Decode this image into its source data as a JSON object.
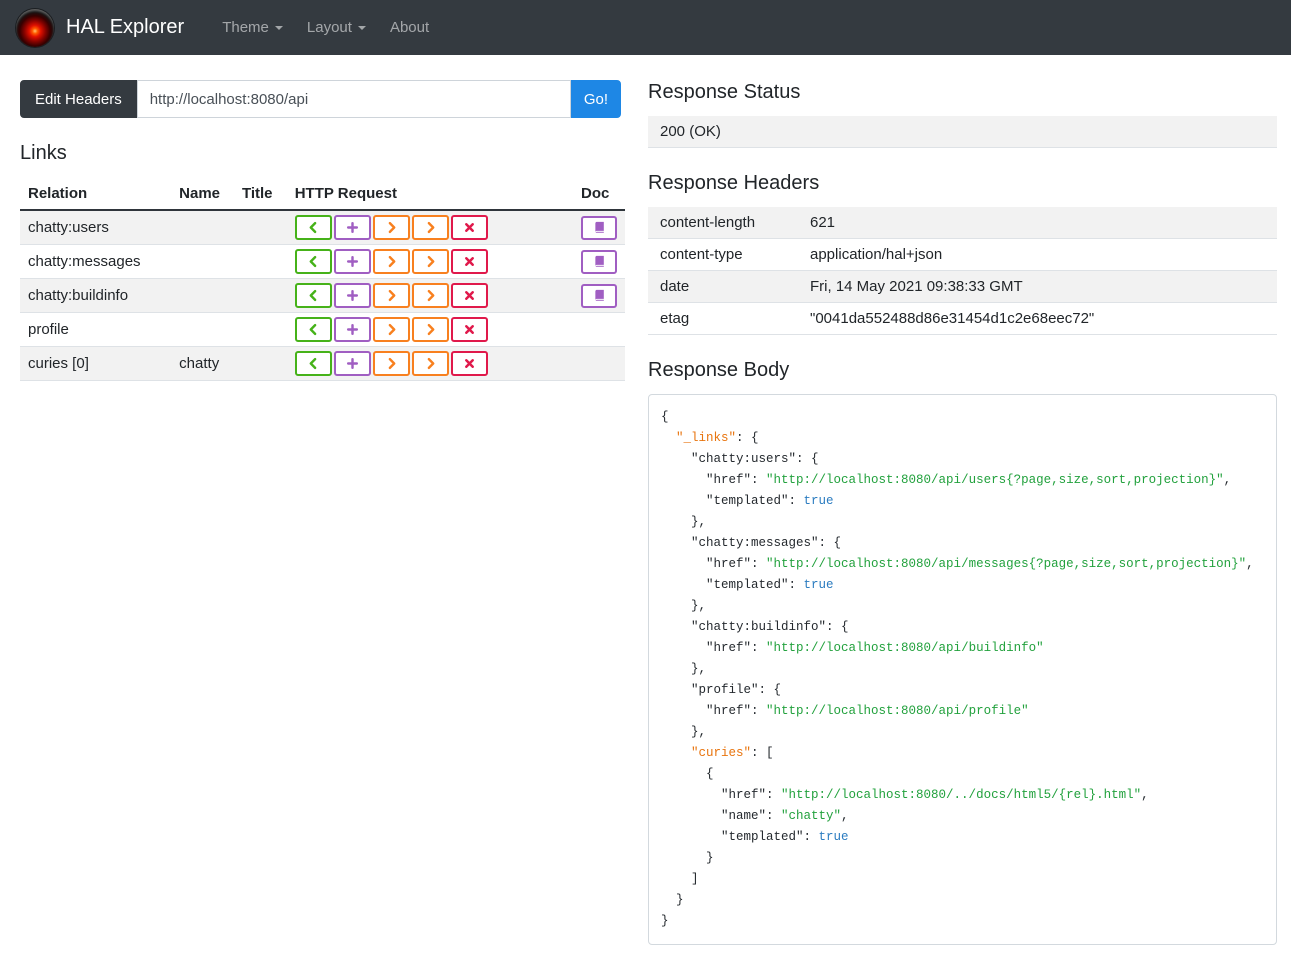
{
  "navbar": {
    "brand": "HAL Explorer",
    "items": [
      {
        "label": "Theme",
        "caret": true
      },
      {
        "label": "Layout",
        "caret": true
      },
      {
        "label": "About",
        "caret": false
      }
    ]
  },
  "request_bar": {
    "edit_headers_label": "Edit Headers",
    "url_value": "http://localhost:8080/api",
    "go_label": "Go!"
  },
  "links": {
    "title": "Links",
    "columns": [
      "Relation",
      "Name",
      "Title",
      "HTTP Request",
      "Doc"
    ],
    "http_buttons": [
      {
        "method": "get",
        "icon": "chevron-left",
        "color": "#46b219"
      },
      {
        "method": "post",
        "icon": "plus",
        "color": "#a05ec2"
      },
      {
        "method": "put",
        "icon": "chevron-right",
        "color": "#f8801f"
      },
      {
        "method": "patch",
        "icon": "chevron-right",
        "color": "#f8801f"
      },
      {
        "method": "delete",
        "icon": "x",
        "color": "#e0194b"
      }
    ],
    "doc_button": {
      "icon": "book",
      "color": "#a05ec2"
    },
    "rows": [
      {
        "relation": "chatty:users",
        "name": "",
        "title": "",
        "doc": true
      },
      {
        "relation": "chatty:messages",
        "name": "",
        "title": "",
        "doc": true
      },
      {
        "relation": "chatty:buildinfo",
        "name": "",
        "title": "",
        "doc": true
      },
      {
        "relation": "profile",
        "name": "",
        "title": "",
        "doc": false
      },
      {
        "relation": "curies [0]",
        "name": "chatty",
        "title": "",
        "doc": false
      }
    ]
  },
  "response_status": {
    "title": "Response Status",
    "value": "200 (OK)"
  },
  "response_headers": {
    "title": "Response Headers",
    "rows": [
      [
        "content-length",
        "621"
      ],
      [
        "content-type",
        "application/hal+json"
      ],
      [
        "date",
        "Fri, 14 May 2021 09:38:33 GMT"
      ],
      [
        "etag",
        "\"0041da552488d86e31454d1c2e68eec72\""
      ]
    ]
  },
  "response_body": {
    "title": "Response Body",
    "lines": [
      [
        [
          "p",
          "{"
        ]
      ],
      [
        [
          "p",
          "  "
        ],
        [
          "k",
          "\"_links\""
        ],
        [
          "p",
          ": {"
        ]
      ],
      [
        [
          "p",
          "    \"chatty:users\": {"
        ]
      ],
      [
        [
          "p",
          "      \"href\": "
        ],
        [
          "s",
          "\"http://localhost:8080/api/users{?page,size,sort,projection}\""
        ],
        [
          "p",
          ","
        ]
      ],
      [
        [
          "p",
          "      \"templated\": "
        ],
        [
          "b",
          "true"
        ]
      ],
      [
        [
          "p",
          "    },"
        ]
      ],
      [
        [
          "p",
          "    \"chatty:messages\": {"
        ]
      ],
      [
        [
          "p",
          "      \"href\": "
        ],
        [
          "s",
          "\"http://localhost:8080/api/messages{?page,size,sort,projection}\""
        ],
        [
          "p",
          ","
        ]
      ],
      [
        [
          "p",
          "      \"templated\": "
        ],
        [
          "b",
          "true"
        ]
      ],
      [
        [
          "p",
          "    },"
        ]
      ],
      [
        [
          "p",
          "    \"chatty:buildinfo\": {"
        ]
      ],
      [
        [
          "p",
          "      \"href\": "
        ],
        [
          "s",
          "\"http://localhost:8080/api/buildinfo\""
        ]
      ],
      [
        [
          "p",
          "    },"
        ]
      ],
      [
        [
          "p",
          "    \"profile\": {"
        ]
      ],
      [
        [
          "p",
          "      \"href\": "
        ],
        [
          "s",
          "\"http://localhost:8080/api/profile\""
        ]
      ],
      [
        [
          "p",
          "    },"
        ]
      ],
      [
        [
          "p",
          "    "
        ],
        [
          "k",
          "\"curies\""
        ],
        [
          "p",
          ": ["
        ]
      ],
      [
        [
          "p",
          "      {"
        ]
      ],
      [
        [
          "p",
          "        \"href\": "
        ],
        [
          "s",
          "\"http://localhost:8080/../docs/html5/{rel}.html\""
        ],
        [
          "p",
          ","
        ]
      ],
      [
        [
          "p",
          "        \"name\": "
        ],
        [
          "s",
          "\"chatty\""
        ],
        [
          "p",
          ","
        ]
      ],
      [
        [
          "p",
          "        \"templated\": "
        ],
        [
          "b",
          "true"
        ]
      ],
      [
        [
          "p",
          "      }"
        ]
      ],
      [
        [
          "p",
          "    ]"
        ]
      ],
      [
        [
          "p",
          "  }"
        ]
      ],
      [
        [
          "p",
          "}"
        ]
      ]
    ]
  },
  "colors": {
    "navbar_bg": "#343a40",
    "go_blue": "#1e87e5",
    "get_green": "#46b219",
    "post_purple": "#a05ec2",
    "put_patch_orange": "#f8801f",
    "delete_red": "#e0194b",
    "doc_purple": "#a05ec2",
    "stripe_gray": "#f2f2f2",
    "code_text": "#24292e",
    "code_key_orange": "#e8740e",
    "code_string_green": "#22a13d",
    "code_literal_blue": "#2b7cc0"
  }
}
